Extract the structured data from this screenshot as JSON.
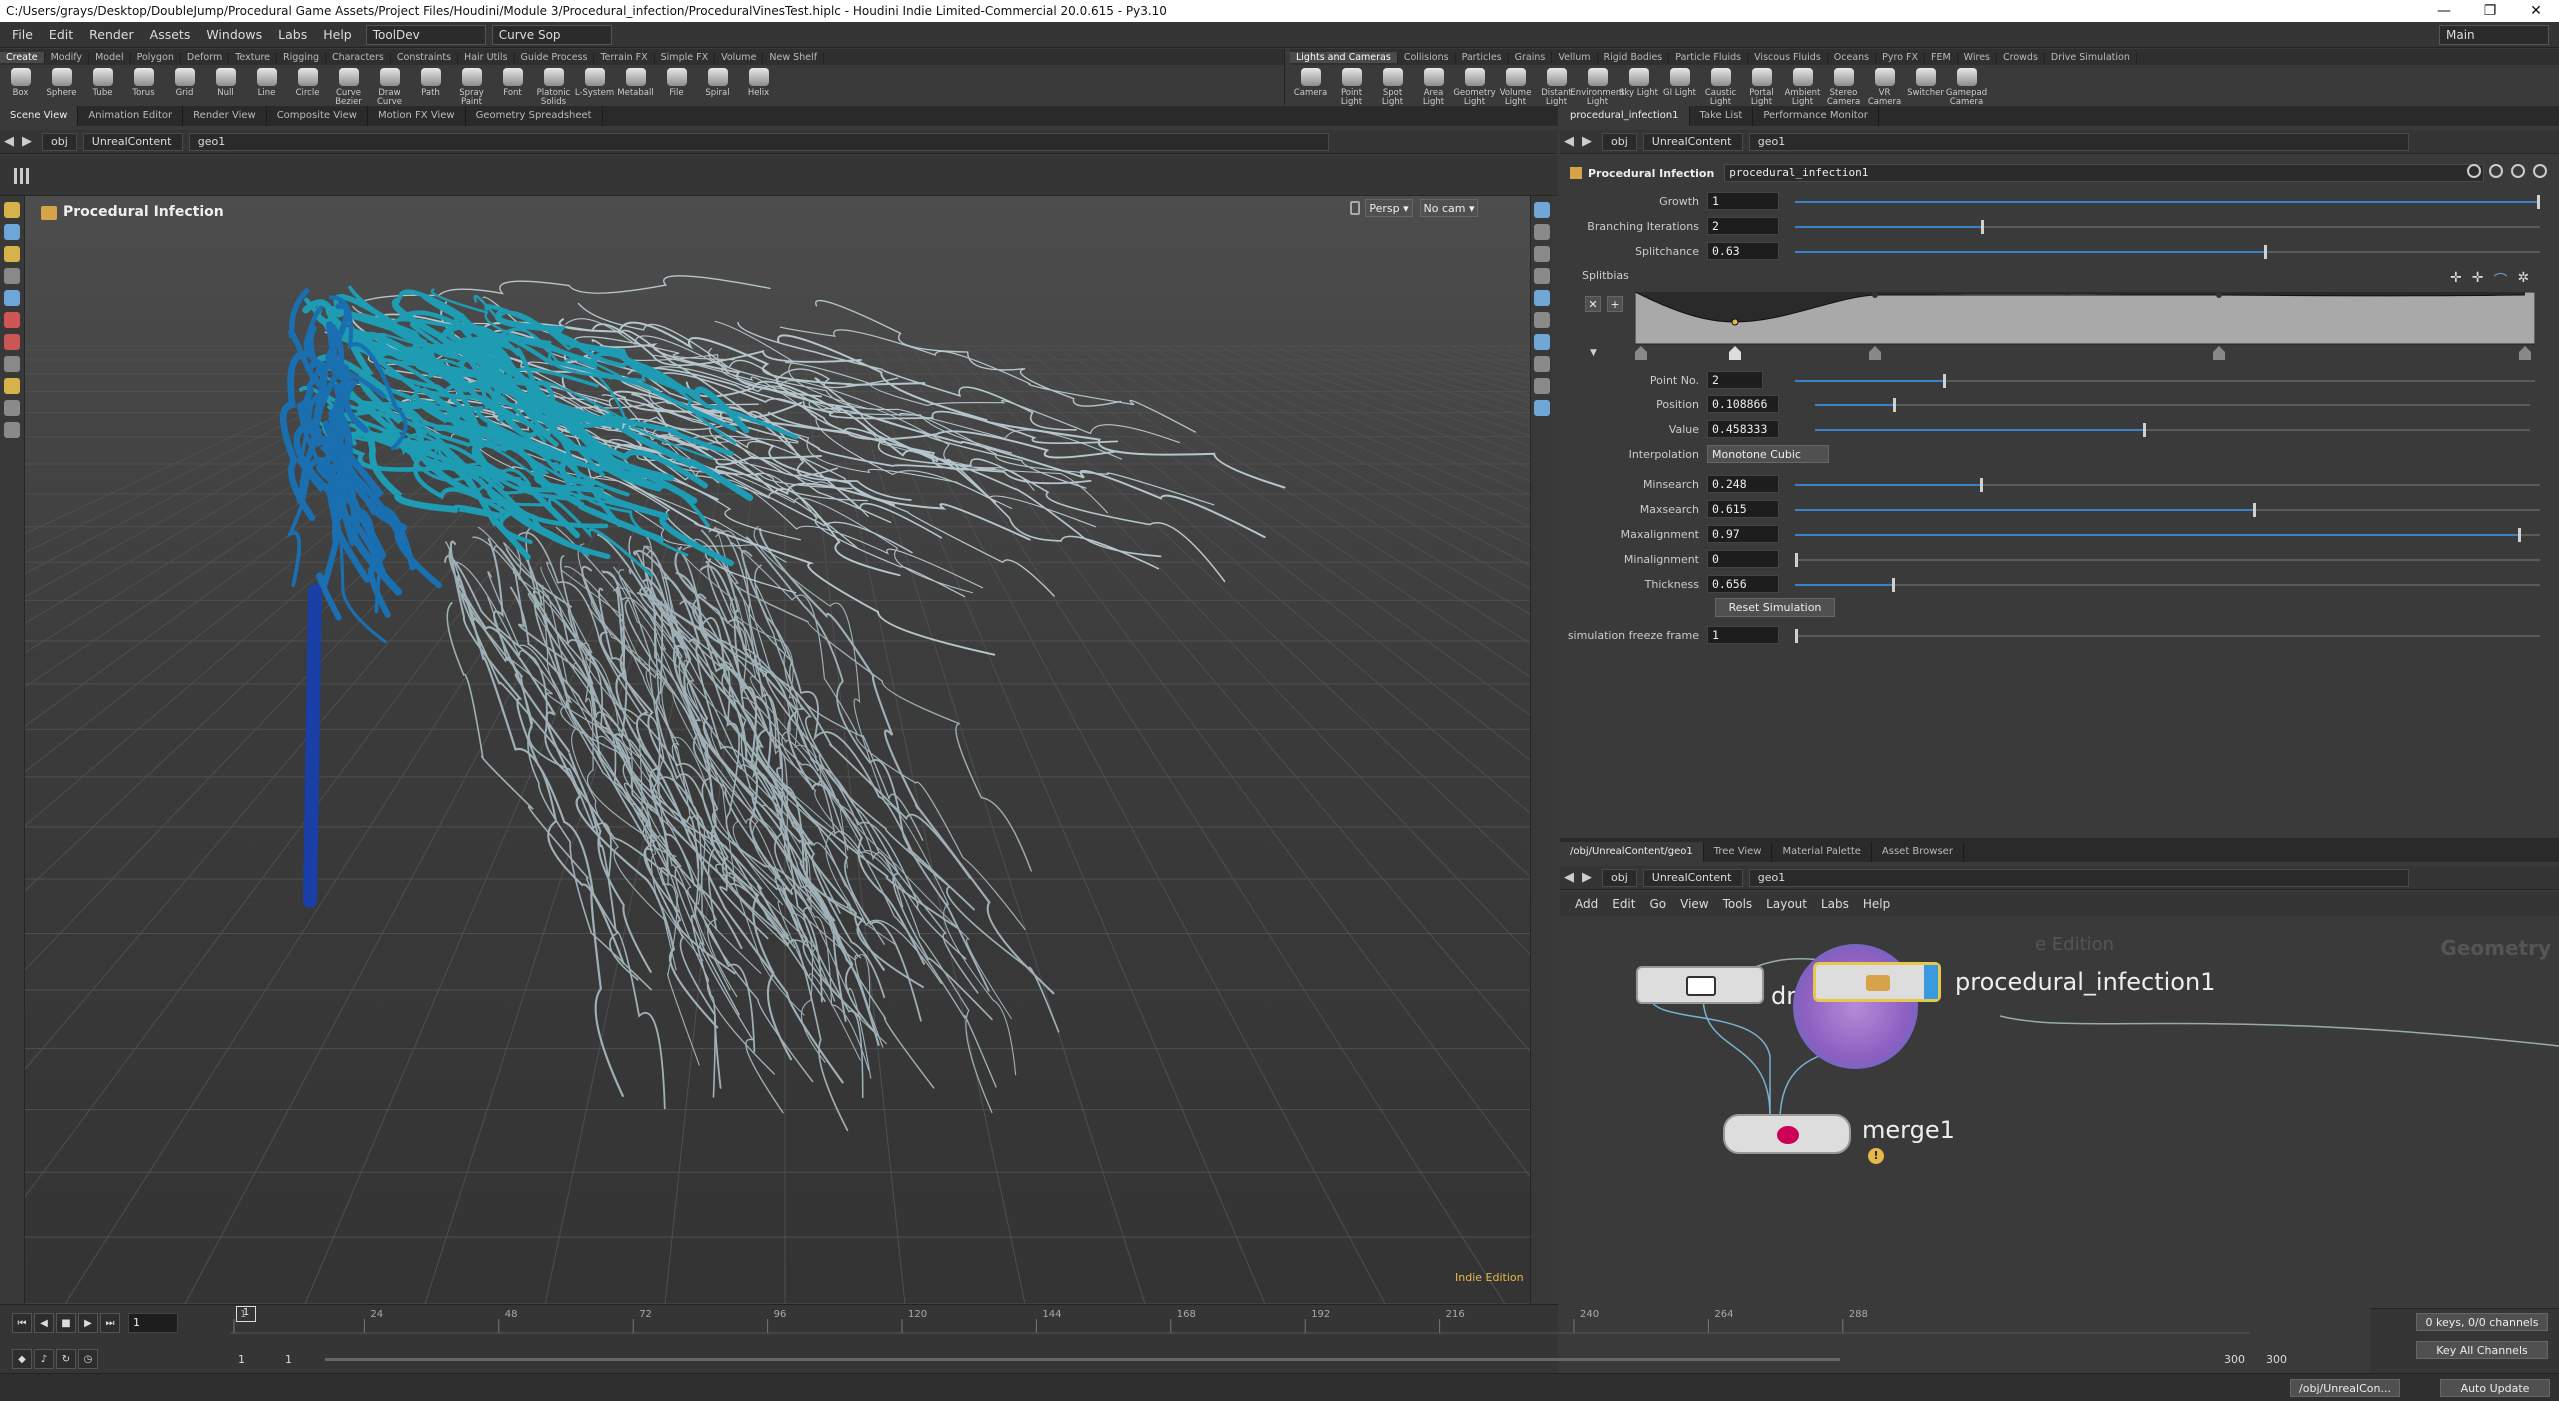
{
  "window": {
    "title": "C:/Users/grays/Desktop/DoubleJump/Procedural Game Assets/Project Files/Houdini/Module 3/Procedural_infection/ProceduralVinesTest.hiplc - Houdini Indie Limited-Commercial 20.0.615 - Py3.10",
    "minimize": "—",
    "maximize": "❐",
    "close": "✕"
  },
  "menu": {
    "items": [
      "File",
      "Edit",
      "Render",
      "Assets",
      "Windows",
      "Labs",
      "Help"
    ],
    "desktop": "ToolDev",
    "context": "Curve Sop",
    "main": "Main"
  },
  "shelf_left": {
    "tabs": [
      "Create",
      "Modify",
      "Model",
      "Polygon",
      "Deform",
      "Texture",
      "Rigging",
      "Characters",
      "Constraints",
      "Hair Utils",
      "Guide Process",
      "Terrain FX",
      "Simple FX",
      "Volume",
      "New Shelf"
    ],
    "tools": [
      "Box",
      "Sphere",
      "Tube",
      "Torus",
      "Grid",
      "Null",
      "Line",
      "Circle",
      "Curve Bezier",
      "Draw Curve",
      "Path",
      "Spray Paint",
      "Font",
      "Platonic Solids",
      "L-System",
      "Metaball",
      "File",
      "Spiral",
      "Helix"
    ]
  },
  "shelf_right": {
    "tabs": [
      "Lights and Cameras",
      "Collisions",
      "Particles",
      "Grains",
      "Vellum",
      "Rigid Bodies",
      "Particle Fluids",
      "Viscous Fluids",
      "Oceans",
      "Pyro FX",
      "FEM",
      "Wires",
      "Crowds",
      "Drive Simulation"
    ],
    "tools": [
      "Camera",
      "Point Light",
      "Spot Light",
      "Area Light",
      "Geometry Light",
      "Volume Light",
      "Distant Light",
      "Environment Light",
      "Sky Light",
      "GI Light",
      "Caustic Light",
      "Portal Light",
      "Ambient Light",
      "Stereo Camera",
      "VR Camera",
      "Switcher",
      "Gamepad Camera"
    ]
  },
  "left_pane": {
    "tabs": [
      "Scene View",
      "Animation Editor",
      "Render View",
      "Composite View",
      "Motion FX View",
      "Geometry Spreadsheet"
    ],
    "path": [
      "obj",
      "UnrealContent",
      "geo1"
    ],
    "viewport_title": "Procedural Infection",
    "persp": "Persp ▾",
    "cam": "No cam ▾",
    "watermark": "Indie Edition"
  },
  "params_pane": {
    "tabs": [
      "procedural_infection1",
      "Take List",
      "Performance Monitor"
    ],
    "path": [
      "obj",
      "UnrealContent",
      "geo1"
    ],
    "node_type": "Procedural Infection",
    "node_name": "procedural_infection1",
    "growth_label": "Growth",
    "growth": "1",
    "growth_frac": 1.0,
    "branching_label": "Branching Iterations",
    "branching": "2",
    "branching_frac": 0.25,
    "splitchance_label": "Splitchance",
    "splitchance": "0.63",
    "splitchance_frac": 0.63,
    "splitbias_label": "Splitbias",
    "pointno_label": "Point No.",
    "pointno": "2",
    "pointno_frac": 0.2,
    "position_label": "Position",
    "position": "0.108866",
    "position_frac": 0.108866,
    "value_label": "Value",
    "value": "0.458333",
    "value_frac": 0.458333,
    "interp_label": "Interpolation",
    "interp": "Monotone Cubic",
    "minsearch_label": "Minsearch",
    "minsearch": "0.248",
    "minsearch_frac": 0.248,
    "maxsearch_label": "Maxsearch",
    "maxsearch": "0.615",
    "maxsearch_frac": 0.615,
    "maxalign_label": "Maxalignment",
    "maxalign": "0.97",
    "maxalign_frac": 0.97,
    "minalign_label": "Minalignment",
    "minalign": "0",
    "minalign_frac": 0.0,
    "thickness_label": "Thickness",
    "thickness": "0.656",
    "thickness_frac": 0.13,
    "reset_label": "Reset Simulation",
    "freeze_label": "simulation freeze frame",
    "freeze": "1",
    "freeze_frac": 0.0
  },
  "network_pane": {
    "tabs": [
      "/obj/UnrealContent/geo1",
      "Tree View",
      "Material Palette",
      "Asset Browser"
    ],
    "path": [
      "obj",
      "UnrealContent",
      "geo1"
    ],
    "menu": [
      "Add",
      "Edit",
      "Go",
      "View",
      "Tools",
      "Layout",
      "Labs",
      "Help"
    ],
    "context_label": "Geometry",
    "edition_label": "e Edition",
    "nodes": {
      "drawcurve": "drawcurve2",
      "infection": "procedural_infection1",
      "merge": "merge1"
    }
  },
  "timeline": {
    "frame": "1",
    "ticks": [
      "1",
      "24",
      "48",
      "72",
      "96",
      "120",
      "144",
      "168",
      "192",
      "216",
      "240",
      "264",
      "288"
    ],
    "start": "1",
    "start2": "1",
    "end": "300",
    "end2": "300",
    "keys": "0 keys, 0/0 channels",
    "key_all": "Key All Channels"
  },
  "status": {
    "path": "/obj/UnrealCon...",
    "update": "Auto Update"
  },
  "colors": {
    "accent": "#3b83c9",
    "vine_dark": "#1a3fa6",
    "vine_mid": "#1e9cb3",
    "vine_light": "#b5c6cc"
  }
}
